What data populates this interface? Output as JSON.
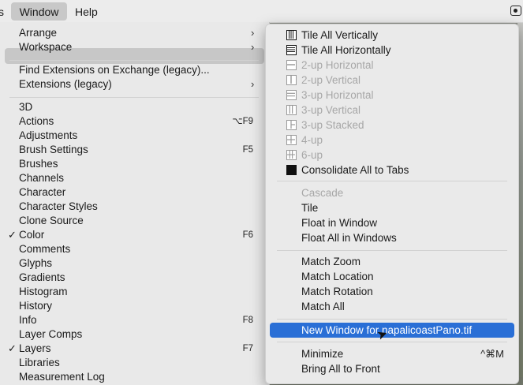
{
  "menubar": {
    "edge": "s",
    "window": "Window",
    "help": "Help",
    "icon": "screen-record-icon"
  },
  "left_menu": {
    "items": [
      {
        "label": "Arrange",
        "arrow": "›"
      },
      {
        "label": "Workspace",
        "arrow": "›"
      },
      {
        "label": "Find Extensions on Exchange (legacy)..."
      },
      {
        "label": "Extensions (legacy)",
        "arrow": "›"
      },
      {
        "label": "3D"
      },
      {
        "label": "Actions",
        "shortcut": "⌥F9"
      },
      {
        "label": "Adjustments"
      },
      {
        "label": "Brush Settings",
        "shortcut": "F5"
      },
      {
        "label": "Brushes"
      },
      {
        "label": "Channels"
      },
      {
        "label": "Character"
      },
      {
        "label": "Character Styles"
      },
      {
        "label": "Clone Source"
      },
      {
        "label": "Color",
        "checked": "✓",
        "shortcut": "F6"
      },
      {
        "label": "Comments"
      },
      {
        "label": "Glyphs"
      },
      {
        "label": "Gradients"
      },
      {
        "label": "Histogram"
      },
      {
        "label": "History"
      },
      {
        "label": "Info",
        "shortcut": "F8"
      },
      {
        "label": "Layer Comps"
      },
      {
        "label": "Layers",
        "checked": "✓",
        "shortcut": "F7"
      },
      {
        "label": "Libraries"
      },
      {
        "label": "Measurement Log"
      }
    ]
  },
  "submenu": {
    "items": [
      {
        "label": "Tile All Vertically"
      },
      {
        "label": "Tile All Horizontally"
      },
      {
        "label": "2-up Horizontal"
      },
      {
        "label": "2-up Vertical"
      },
      {
        "label": "3-up Horizontal"
      },
      {
        "label": "3-up Vertical"
      },
      {
        "label": "3-up Stacked"
      },
      {
        "label": "4-up"
      },
      {
        "label": "6-up"
      },
      {
        "label": "Consolidate All to Tabs"
      },
      {
        "label": "Cascade"
      },
      {
        "label": "Tile"
      },
      {
        "label": "Float in Window"
      },
      {
        "label": "Float All in Windows"
      },
      {
        "label": "Match Zoom"
      },
      {
        "label": "Match Location"
      },
      {
        "label": "Match Rotation"
      },
      {
        "label": "Match All"
      },
      {
        "label": "New Window for napalicoastPano.tif"
      },
      {
        "label": "Minimize",
        "shortcut": "^⌘M"
      },
      {
        "label": "Bring All to Front"
      }
    ]
  },
  "colors": {
    "highlight": "#2a6fd6",
    "menu_bg": "#e9e9e9",
    "disabled_text": "#a7a7a7"
  }
}
